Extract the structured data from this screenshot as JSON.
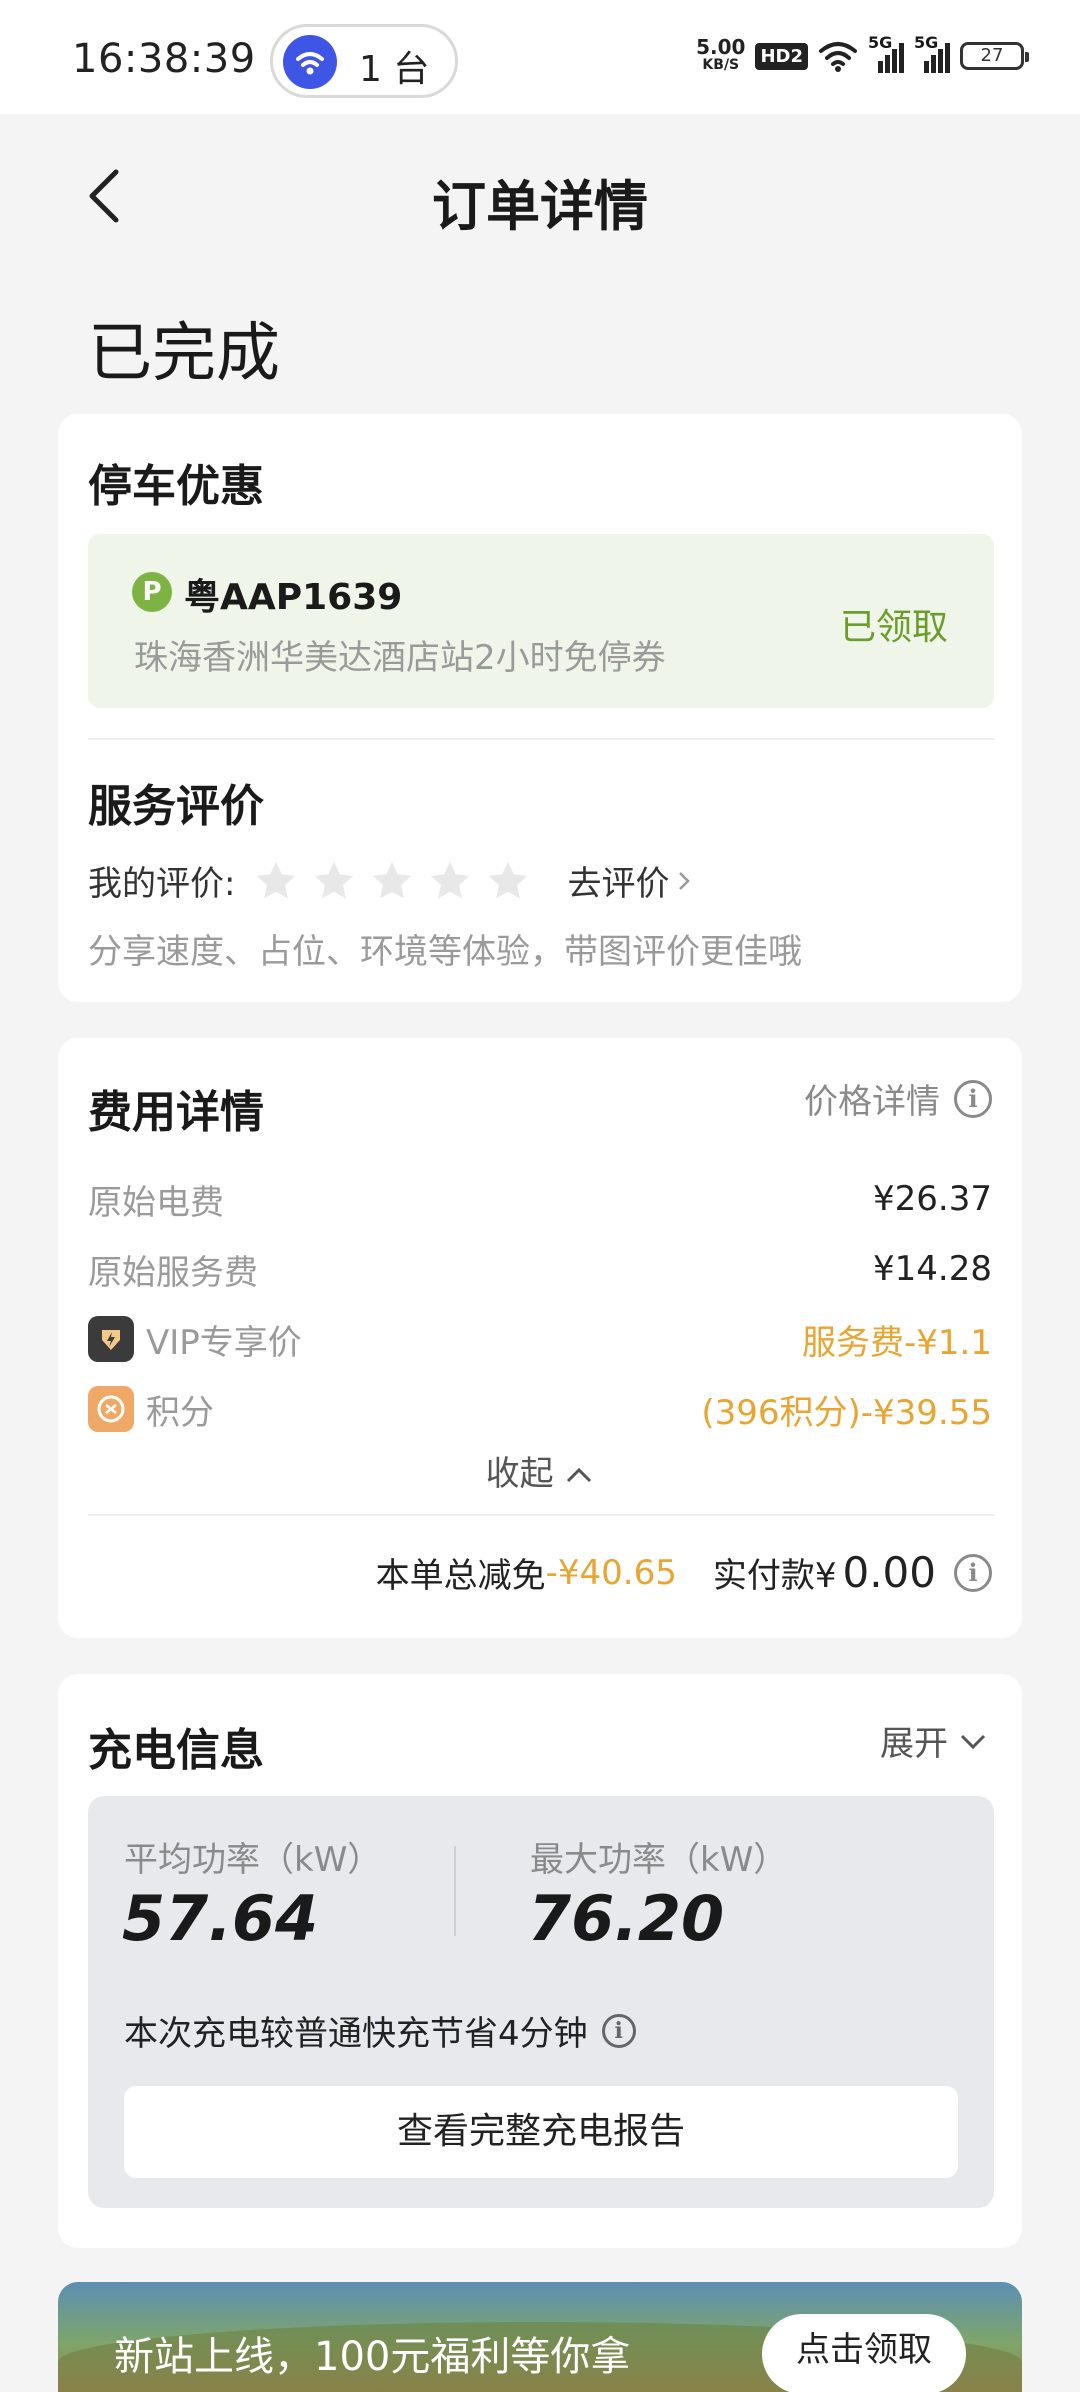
{
  "status_bar": {
    "time": "16:38:39",
    "pill_text": "1 台",
    "net_speed": "5.00",
    "net_unit": "KB/S",
    "hd_label": "HD2",
    "signal1_label": "5G",
    "signal2_label": "5G",
    "battery": "27"
  },
  "nav": {
    "title": "订单详情"
  },
  "order_status": "已完成",
  "parking": {
    "title": "停车优惠",
    "badge": "P",
    "plate": "粤AAP1639",
    "description": "珠海香洲华美达酒店站2小时免停券",
    "status": "已领取"
  },
  "review": {
    "title": "服务评价",
    "my_rating_label": "我的评价:",
    "rating_value": 0,
    "rating_max": 5,
    "go_rate": "去评价",
    "hint": "分享速度、占位、环境等体验，带图评价更佳哦"
  },
  "fees": {
    "title": "费用详情",
    "price_detail_link": "价格详情",
    "rows": [
      {
        "label": "原始电费",
        "value": "¥26.37"
      },
      {
        "label": "原始服务费",
        "value": "¥14.28"
      },
      {
        "label": "VIP专享价",
        "value": "服务费-¥1.1"
      },
      {
        "label": "积分",
        "value": "(396积分)-¥39.55"
      }
    ],
    "collapse": "收起",
    "total_discount_label": "本单总减免",
    "total_discount_value": "-¥40.65",
    "paid_label": "实付款¥",
    "paid_value": "0.00"
  },
  "charging": {
    "title": "充电信息",
    "expand": "展开",
    "avg_power_label": "平均功率（kW）",
    "avg_power_value": "57.64",
    "max_power_label": "最大功率（kW）",
    "max_power_value": "76.20",
    "saved_note": "本次充电较普通快充节省4分钟",
    "report_button": "查看完整充电报告"
  },
  "banner": {
    "text": "新站上线，100元福利等你拿",
    "button": "点击领取"
  },
  "colors": {
    "accent_green": "#6a9d2a",
    "accent_orange": "#e8a532",
    "brand_blue": "#3f55e6"
  }
}
